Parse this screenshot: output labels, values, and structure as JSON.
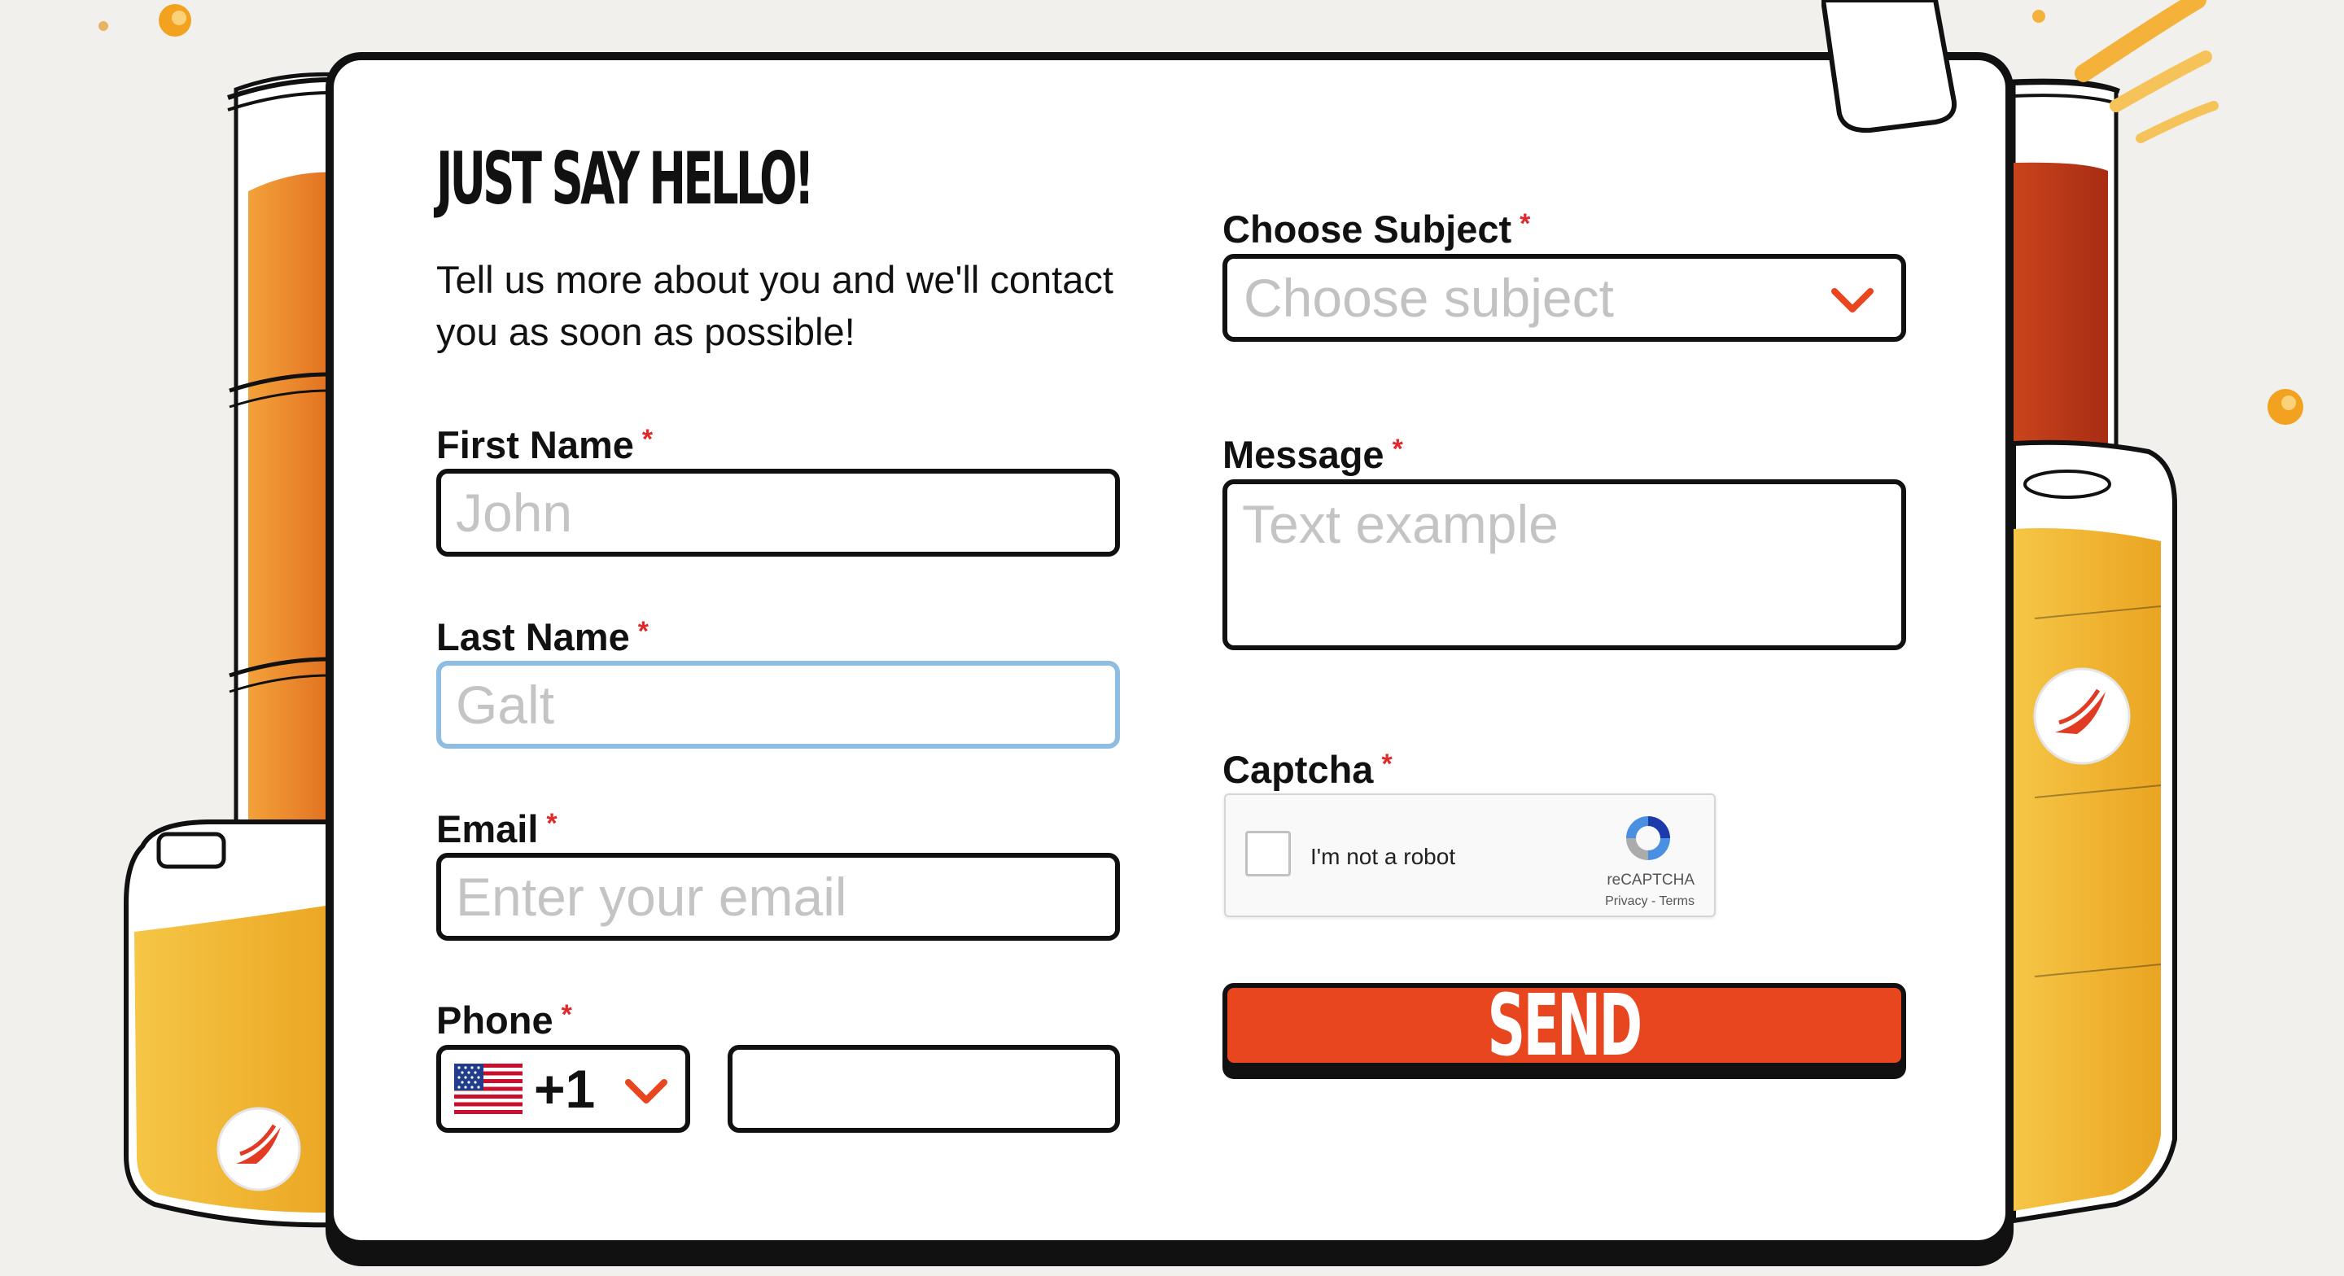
{
  "form": {
    "title": "JUST SAY HELLO!",
    "subtitle": "Tell us more about you and we'll contact you as soon as possible!",
    "required_mark": "*",
    "first_name": {
      "label": "First Name",
      "placeholder": "John"
    },
    "last_name": {
      "label": "Last Name",
      "placeholder": "Galt"
    },
    "email": {
      "label": "Email",
      "placeholder": "Enter your email"
    },
    "phone": {
      "label": "Phone",
      "country_code": "+1",
      "value": ""
    },
    "subject": {
      "label": "Choose Subject",
      "placeholder": "Choose subject"
    },
    "message": {
      "label": "Message",
      "placeholder": "Text example"
    },
    "captcha": {
      "label": "Captcha",
      "checkbox_text": "I'm not a robot",
      "brand": "reCAPTCHA",
      "links": "Privacy - Terms"
    },
    "send_label": "SEND"
  },
  "colors": {
    "accent": "#e8461f",
    "required": "#e0292b",
    "focus_border": "#8fbde2",
    "background": "#f1f0ec"
  },
  "icons": {
    "dropdown": "chevron-down-icon",
    "flag": "us-flag-icon",
    "captcha": "recaptcha-logo-icon",
    "brand_badge": "leaf-logo-icon"
  }
}
